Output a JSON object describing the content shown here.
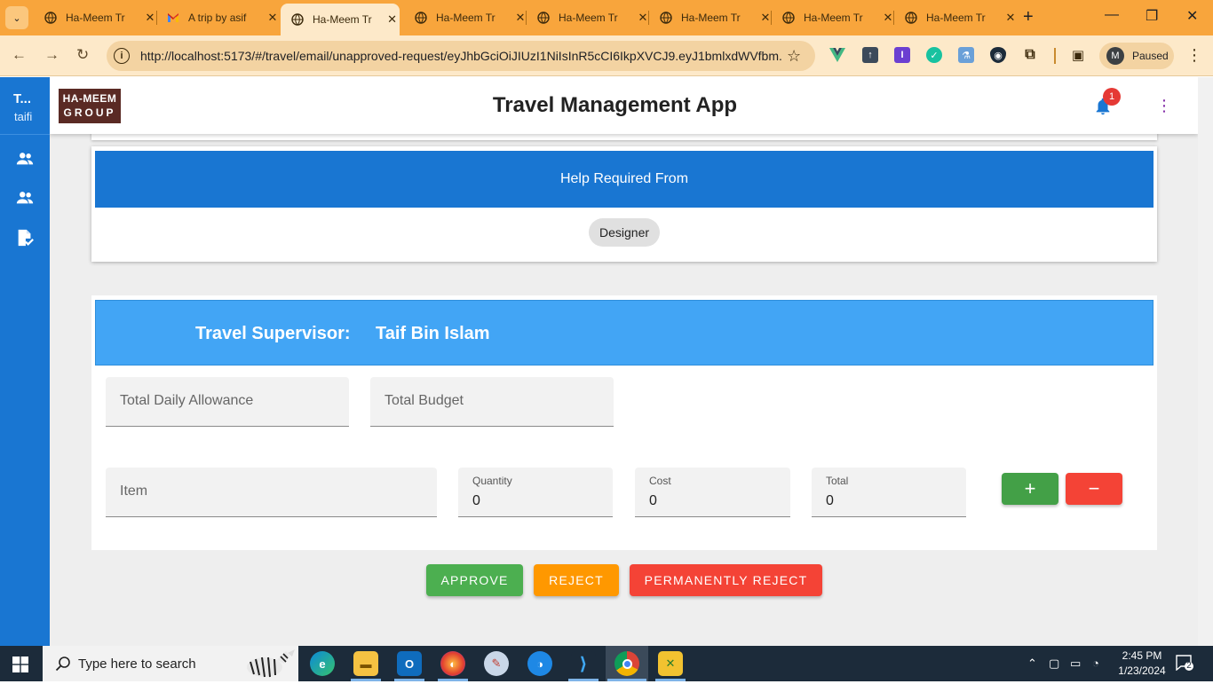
{
  "browser": {
    "tabs": [
      {
        "title": "Ha-Meem Tr",
        "icon": "globe-icon",
        "active": false
      },
      {
        "title": "A trip by asif",
        "icon": "gmail-icon",
        "active": false
      },
      {
        "title": "Ha-Meem Tr",
        "icon": "globe-icon",
        "active": true
      },
      {
        "title": "Ha-Meem Tr",
        "icon": "globe-icon",
        "active": false
      },
      {
        "title": "Ha-Meem Tr",
        "icon": "globe-icon",
        "active": false
      },
      {
        "title": "Ha-Meem Tr",
        "icon": "globe-icon",
        "active": false
      },
      {
        "title": "Ha-Meem Tr",
        "icon": "globe-icon",
        "active": false
      },
      {
        "title": "Ha-Meem Tr",
        "icon": "globe-icon",
        "active": false
      }
    ],
    "url": "http://localhost:5173/#/travel/email/unapproved-request/eyJhbGciOiJIUzI1NiIsInR5cCI6IkpXVCJ9.eyJ1bmlxdWVfbm...",
    "profile": {
      "initial": "M",
      "status": "Paused"
    },
    "colors": {
      "frame": "#f8a53c",
      "toolbar": "#fde9c9"
    }
  },
  "sidebar": {
    "brand_title": "T...",
    "brand_user": "taifi",
    "items": [
      "group-icon",
      "group-icon",
      "assignment-approve-icon"
    ]
  },
  "appbar": {
    "logo_line1": "HA-MEEM",
    "logo_line2": "GROUP",
    "title": "Travel Management App",
    "notification_count": "1"
  },
  "help_card": {
    "header": "Help Required From",
    "chips": [
      "Designer"
    ]
  },
  "supervisor_card": {
    "label": "Travel Supervisor:",
    "name": "Taif Bin Islam",
    "fields": {
      "daily_allowance_placeholder": "Total Daily Allowance",
      "budget_placeholder": "Total Budget"
    },
    "item_row": {
      "item_placeholder": "Item",
      "quantity_label": "Quantity",
      "quantity_value": "0",
      "cost_label": "Cost",
      "cost_value": "0",
      "total_label": "Total",
      "total_value": "0",
      "add_label": "+",
      "remove_label": "−"
    }
  },
  "actions": {
    "approve": "APPROVE",
    "reject": "REJECT",
    "permanently_reject": "PERMANENTLY REJECT",
    "colors": {
      "approve": "#4caf50",
      "reject": "#ff9800",
      "permanently_reject": "#f44336"
    }
  },
  "taskbar": {
    "search_placeholder": "Type here to search",
    "time": "2:45 PM",
    "date": "1/23/2024",
    "notification_count": "2"
  }
}
